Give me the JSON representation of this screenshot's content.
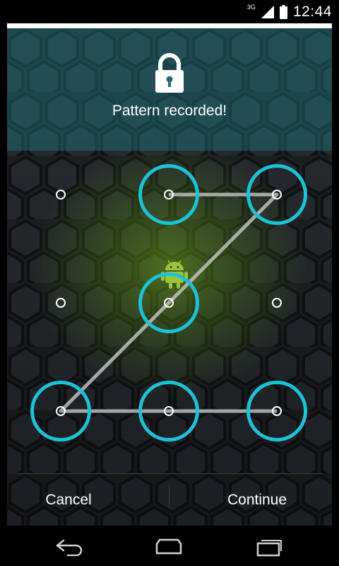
{
  "status_bar": {
    "network_type": "3G",
    "time": "12:44",
    "icons": [
      "signal-icon",
      "battery-icon"
    ]
  },
  "header": {
    "icon": "lock-icon",
    "message": "Pattern recorded!"
  },
  "pattern": {
    "grid": "3x3",
    "selected_sequence": [
      2,
      3,
      5,
      7,
      8,
      9
    ],
    "accent_color": "#1cc2d6",
    "center_icon": "android-icon"
  },
  "buttons": {
    "cancel_label": "Cancel",
    "continue_label": "Continue"
  },
  "nav": {
    "icons": [
      "back-icon",
      "home-icon",
      "recent-apps-icon"
    ]
  }
}
